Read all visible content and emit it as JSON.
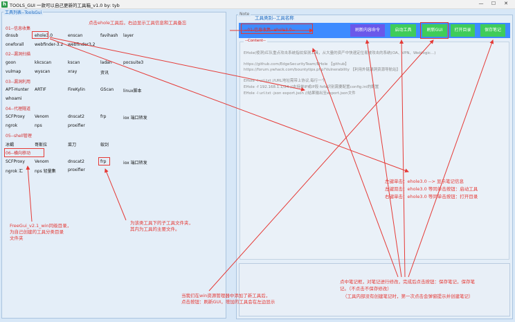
{
  "window": {
    "title": "TOOLS_GUI  一款可以自己更新的工具箱_v1.0   by: tyb",
    "controls": [
      "—",
      "☐",
      "✕"
    ]
  },
  "left_panel": {
    "legend": "工具列表--ToolsGui",
    "sections": [
      {
        "title": "01--信息收集",
        "tools": [
          "dnsub",
          "ehole3.0",
          "enscan",
          "favihash",
          "layer",
          "oneforall",
          "webfinder-3.2",
          "webfinder3.2"
        ]
      },
      {
        "title": "02--漏洞扫描",
        "tools": [
          "goon",
          "kkcscan",
          "kscan",
          "ladan",
          "pocsuite3",
          "vulmap",
          "wyscan",
          "xray",
          "资讯"
        ]
      },
      {
        "title": "03--漏洞利用",
        "tools": [
          "APT-Hunter",
          "ARTIF",
          "FireKylin",
          "GScan",
          "linux脚本",
          "whoami"
        ]
      },
      {
        "title": "04--代理隧道",
        "tools": [
          "SCFProxy",
          "Venom",
          "dnscat2",
          "frp",
          "iox 端口转发",
          "ngrok",
          "nps",
          "proxifier"
        ]
      },
      {
        "title": "05--shell管理",
        "tools": [
          "冰蝎",
          "哥斯拉",
          "菜刀",
          "蚁剑"
        ]
      },
      {
        "title": "06--横向移动",
        "tools": [
          "SCFProxy",
          "Venom",
          "dnscat2",
          "frp",
          "iox 端口转发",
          "ngrok 汇",
          "nps 轻量集",
          "proxifier"
        ]
      }
    ]
  },
  "right_panel": {
    "legend": "Note",
    "tool_label": "--01-信息收集--ehole3.0--",
    "buttons": [
      "刷新内容命令",
      "启动工具",
      "刷新GUI",
      "打开目录",
      "保存笔记"
    ],
    "content_legend": "--Content--",
    "content_lines": [
      "EHole(棱洞)红队重点攻击系统指纹探测工具，从大量的资产中快速定位易被攻击的系统(OA、VPN、Weblogic...)",
      "https://github.com/EdgeSecurityTeam/EHole   【github】",
      "https://forum.ywhack.com/bountytips.php?Vulnerability 【利用外链漏洞资源导航站】",
      "EHole -l url.txt   //URL地址需带上协议,每行一个",
      "EHole -f 192.168.1.1/24  //支持单IP或IP段 fofa识别需要配置config.ini的配置",
      "EHole -l url.txt -json export.json  //结果输出至export.json文件"
    ]
  },
  "annotations": {
    "click_tool": "点击ehole工具后，右边显示工具信息和工具备忘",
    "tool_category": "工具类别--工具名称",
    "left_single": "左键单击：ehole3.0  --> 显示笔记信息",
    "left_double": "左键双击：ehole3.0  等同单击按钮：启动工具",
    "right_single": "右键单击：ehole3.0  等同单击按钮：打开目录",
    "freegui_1": "FreeGui_v2.1_win同级目录，",
    "freegui_2": "为自己创建的工具分类目录",
    "freegui_3": "文件夹",
    "subfolder_1": "为该类工具下的子工具文件夹，",
    "subfolder_2": "其内为工具的主要文件。",
    "refresh_1": "当我们在win资源管理器中添加了新工具后，",
    "refresh_2": "点击按钮：刷新GUI，增加的工具会在左边显示",
    "note_1": "点中笔记框，对笔记进行修改，完成后点击按钮：保存笔记，保存笔",
    "note_2": "记。（不点击不保存修改）",
    "note_3": "（工具内部没有创建笔记时，第一次点击会弹窗提示并创建笔记）"
  },
  "colors": {
    "toolbar": "#3d8bff",
    "button_purple": "#6a58ea",
    "button_green": "#3fcc5a",
    "annotation_red": "#e53935"
  }
}
